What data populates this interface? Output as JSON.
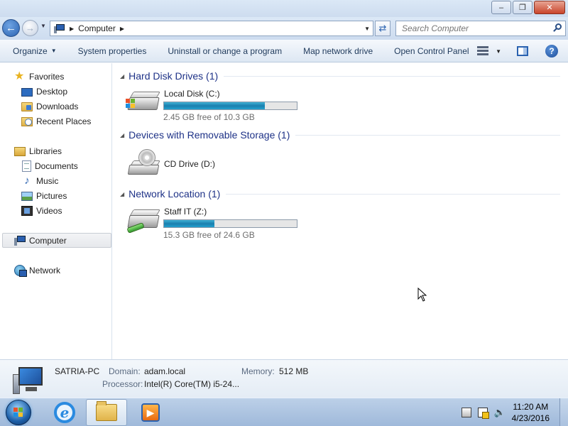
{
  "window": {
    "minimize": "–",
    "maximize": "❐",
    "close": "✕"
  },
  "address": {
    "crumb": "Computer",
    "search_placeholder": "Search Computer"
  },
  "toolbar": {
    "organize": "Organize",
    "items": [
      "System properties",
      "Uninstall or change a program",
      "Map network drive",
      "Open Control Panel"
    ]
  },
  "nav": {
    "favorites": "Favorites",
    "desktop": "Desktop",
    "downloads": "Downloads",
    "recent_places": "Recent Places",
    "libraries": "Libraries",
    "documents": "Documents",
    "music": "Music",
    "pictures": "Pictures",
    "videos": "Videos",
    "computer": "Computer",
    "network": "Network"
  },
  "groups": [
    {
      "title": "Hard Disk Drives (1)",
      "drives": [
        {
          "name": "Local Disk (C:)",
          "free_text": "2.45 GB free of 10.3 GB",
          "used_fraction": 0.762
        }
      ]
    },
    {
      "title": "Devices with Removable Storage (1)",
      "drives": [
        {
          "name": "CD Drive (D:)"
        }
      ]
    },
    {
      "title": "Network Location (1)",
      "drives": [
        {
          "name": "Staff IT (Z:)",
          "free_text": "15.3 GB free of 24.6 GB",
          "used_fraction": 0.378
        }
      ]
    }
  ],
  "details": {
    "pc_name": "SATRIA-PC",
    "domain_label": "Domain:",
    "domain_value": "adam.local",
    "memory_label": "Memory:",
    "memory_value": "512 MB",
    "processor_label": "Processor:",
    "processor_value": "Intel(R) Core(TM) i5-24..."
  },
  "taskbar": {
    "time": "11:20 AM",
    "date": "4/23/2016"
  },
  "colors": {
    "group_title": "#1e3287",
    "bar_fill": "#23a0cd",
    "toolbar_text": "#1e395b"
  }
}
